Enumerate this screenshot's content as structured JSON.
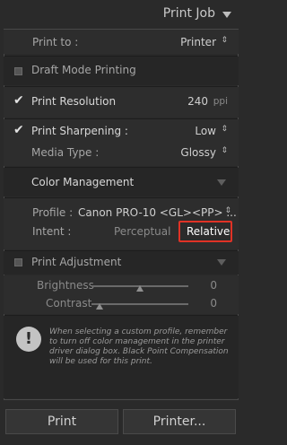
{
  "panel": {
    "title": "Print Job"
  },
  "print_to": {
    "label": "Print to :",
    "value": "Printer"
  },
  "draft_mode": {
    "label": "Draft Mode Printing",
    "checked": false
  },
  "print_resolution": {
    "label": "Print Resolution",
    "checked": true,
    "value": "240",
    "unit": "ppi"
  },
  "print_sharpening": {
    "label": "Print Sharpening :",
    "checked": true,
    "value": "Low"
  },
  "media_type": {
    "label": "Media Type :",
    "value": "Glossy"
  },
  "color_management": {
    "title": "Color Management",
    "profile_label": "Profile :",
    "profile_value": "Canon PRO-10 <GL><PP> ...",
    "intent_label": "Intent :",
    "intent_options": [
      "Perceptual",
      "Relative"
    ],
    "intent_selected": "Relative"
  },
  "print_adjustment": {
    "label": "Print Adjustment",
    "checked": false,
    "brightness_label": "Brightness",
    "brightness_value": "0",
    "contrast_label": "Contrast",
    "contrast_value": "0"
  },
  "note": {
    "line1": "When selecting a custom profile, remember",
    "line2": "to turn off color management in the printer",
    "line3": "driver dialog box. Black Point Compensation",
    "line4": "will be used for this print."
  },
  "buttons": {
    "print": "Print",
    "printer": "Printer..."
  },
  "icons": [
    "collapse-triangle-icon",
    "checkbox-icon",
    "checkmark-icon",
    "updown-arrows-icon",
    "warning-icon",
    "slider-knob-icon"
  ]
}
